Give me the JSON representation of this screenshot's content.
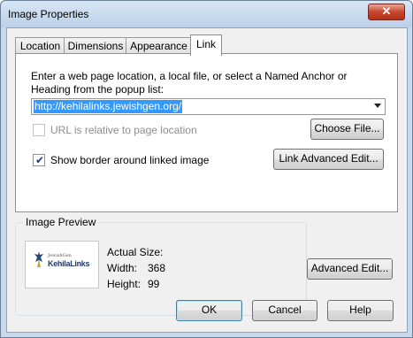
{
  "window": {
    "title": "Image Properties",
    "close_glyph": "✕"
  },
  "tabs": [
    {
      "label": "Location"
    },
    {
      "label": "Dimensions"
    },
    {
      "label": "Appearance"
    },
    {
      "label": "Link",
      "active": true
    }
  ],
  "link_panel": {
    "description": "Enter a web page location, a local file, or select a Named Anchor or Heading from the popup list:",
    "url_value": "http://kehilalinks.jewishgen.org/",
    "relative_checkbox": {
      "label": "URL is relative to page location",
      "checked": false,
      "enabled": false
    },
    "choose_file_button": "Choose File...",
    "border_checkbox": {
      "label": "Show border around linked image",
      "checked": true,
      "enabled": true
    },
    "link_advanced_button": "Link Advanced Edit..."
  },
  "preview": {
    "group_title": "Image Preview",
    "logo_small_text": "JewishGen",
    "logo_main_text": "KehilaLinks",
    "actual_size_label": "Actual Size:",
    "width_label": "Width:",
    "width_value": "368",
    "height_label": "Height:",
    "height_value": "99"
  },
  "buttons": {
    "advanced_edit": "Advanced Edit...",
    "ok": "OK",
    "cancel": "Cancel",
    "help": "Help"
  },
  "icons": {
    "checkmark": "✔",
    "close": "close-icon",
    "dropdown": "chevron-down-icon"
  },
  "colors": {
    "selection": "#3399ff",
    "close_button": "#c9452d",
    "default_button_border": "#3c7fb1"
  }
}
